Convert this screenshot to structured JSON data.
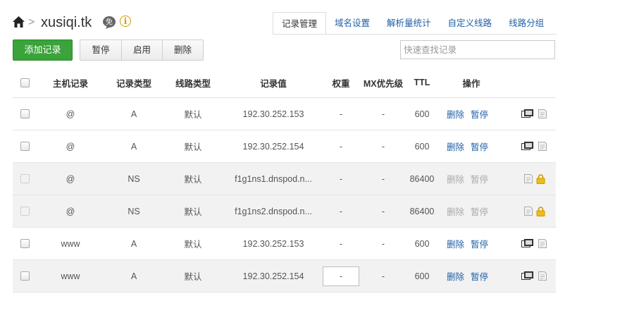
{
  "header": {
    "domain": "xusiqi.tk",
    "badge_text": "免",
    "info_glyph": "i",
    "separator": ">",
    "tabs": [
      "记录管理",
      "域名设置",
      "解析量统计",
      "自定义线路",
      "线路分组"
    ]
  },
  "toolbar": {
    "add_label": "添加记录",
    "pause_label": "暂停",
    "enable_label": "启用",
    "delete_label": "删除",
    "search_placeholder": "快速查找记录"
  },
  "table": {
    "columns": {
      "host": "主机记录",
      "type": "记录类型",
      "line": "线路类型",
      "value": "记录值",
      "weight": "权重",
      "mx": "MX优先级",
      "ttl": "TTL",
      "ops": "操作"
    },
    "rows": [
      {
        "host": "@",
        "type": "A",
        "line": "默认",
        "value": "192.30.252.153",
        "weight": "-",
        "mx": "-",
        "ttl": "600",
        "delete": "删除",
        "pause": "暂停"
      },
      {
        "host": "@",
        "type": "A",
        "line": "默认",
        "value": "192.30.252.154",
        "weight": "-",
        "mx": "-",
        "ttl": "600",
        "delete": "删除",
        "pause": "暂停"
      },
      {
        "host": "@",
        "type": "NS",
        "line": "默认",
        "value": "f1g1ns1.dnspod.n...",
        "weight": "-",
        "mx": "-",
        "ttl": "86400",
        "delete": "删除",
        "pause": "暂停"
      },
      {
        "host": "@",
        "type": "NS",
        "line": "默认",
        "value": "f1g1ns2.dnspod.n...",
        "weight": "-",
        "mx": "-",
        "ttl": "86400",
        "delete": "删除",
        "pause": "暂停"
      },
      {
        "host": "www",
        "type": "A",
        "line": "默认",
        "value": "192.30.252.153",
        "weight": "-",
        "mx": "-",
        "ttl": "600",
        "delete": "删除",
        "pause": "暂停"
      },
      {
        "host": "www",
        "type": "A",
        "line": "默认",
        "value": "192.30.252.154",
        "weight": "-",
        "mx": "-",
        "ttl": "600",
        "delete": "删除",
        "pause": "暂停"
      }
    ]
  },
  "icons": [
    "home-icon",
    "chevron-right-icon",
    "free-badge-icon",
    "info-icon",
    "remark-monitor-icon",
    "note-icon",
    "lock-icon"
  ],
  "colors": {
    "accent_green": "#3aa33a",
    "link_blue": "#1f5fa6",
    "lock_gold": "#e8b400"
  }
}
